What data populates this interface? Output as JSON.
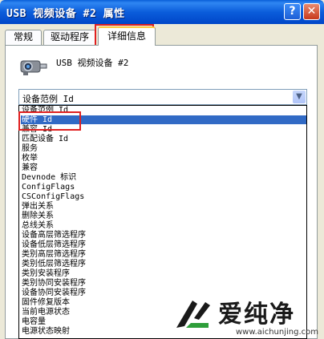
{
  "window": {
    "title": "USB 视频设备 #2 属性",
    "help_glyph": "?",
    "close_glyph": "✕"
  },
  "tabs": [
    {
      "label": "常规"
    },
    {
      "label": "驱动程序"
    },
    {
      "label": "详细信息",
      "active": true
    }
  ],
  "device": {
    "icon": "usb-camera-icon",
    "name": "USB 视频设备 #2"
  },
  "property_select": {
    "selected": "设备范例 Id",
    "options": [
      "设备范例 Id",
      "硬件 Id",
      "兼容 Id",
      "匹配设备 Id",
      "服务",
      "枚举",
      "兼容",
      "Devnode 标识",
      "ConfigFlags",
      "CSConfigFlags",
      "弹出关系",
      "删除关系",
      "总线关系",
      "设备高层筛选程序",
      "设备低层筛选程序",
      "类别高层筛选程序",
      "类别低层筛选程序",
      "类别安装程序",
      "类别协同安装程序",
      "设备协同安装程序",
      "固件修复版本",
      "当前电源状态",
      "电容量",
      "电源状态映射"
    ],
    "highlighted": "硬件 Id"
  },
  "watermark": {
    "title": "爱纯净",
    "url": "www.aichunjing.com",
    "accent": "#2E9E3A"
  },
  "colors": {
    "titlebar": "#0A5FD8",
    "selection": "#316AC5",
    "annotation_box": "#E02020"
  }
}
